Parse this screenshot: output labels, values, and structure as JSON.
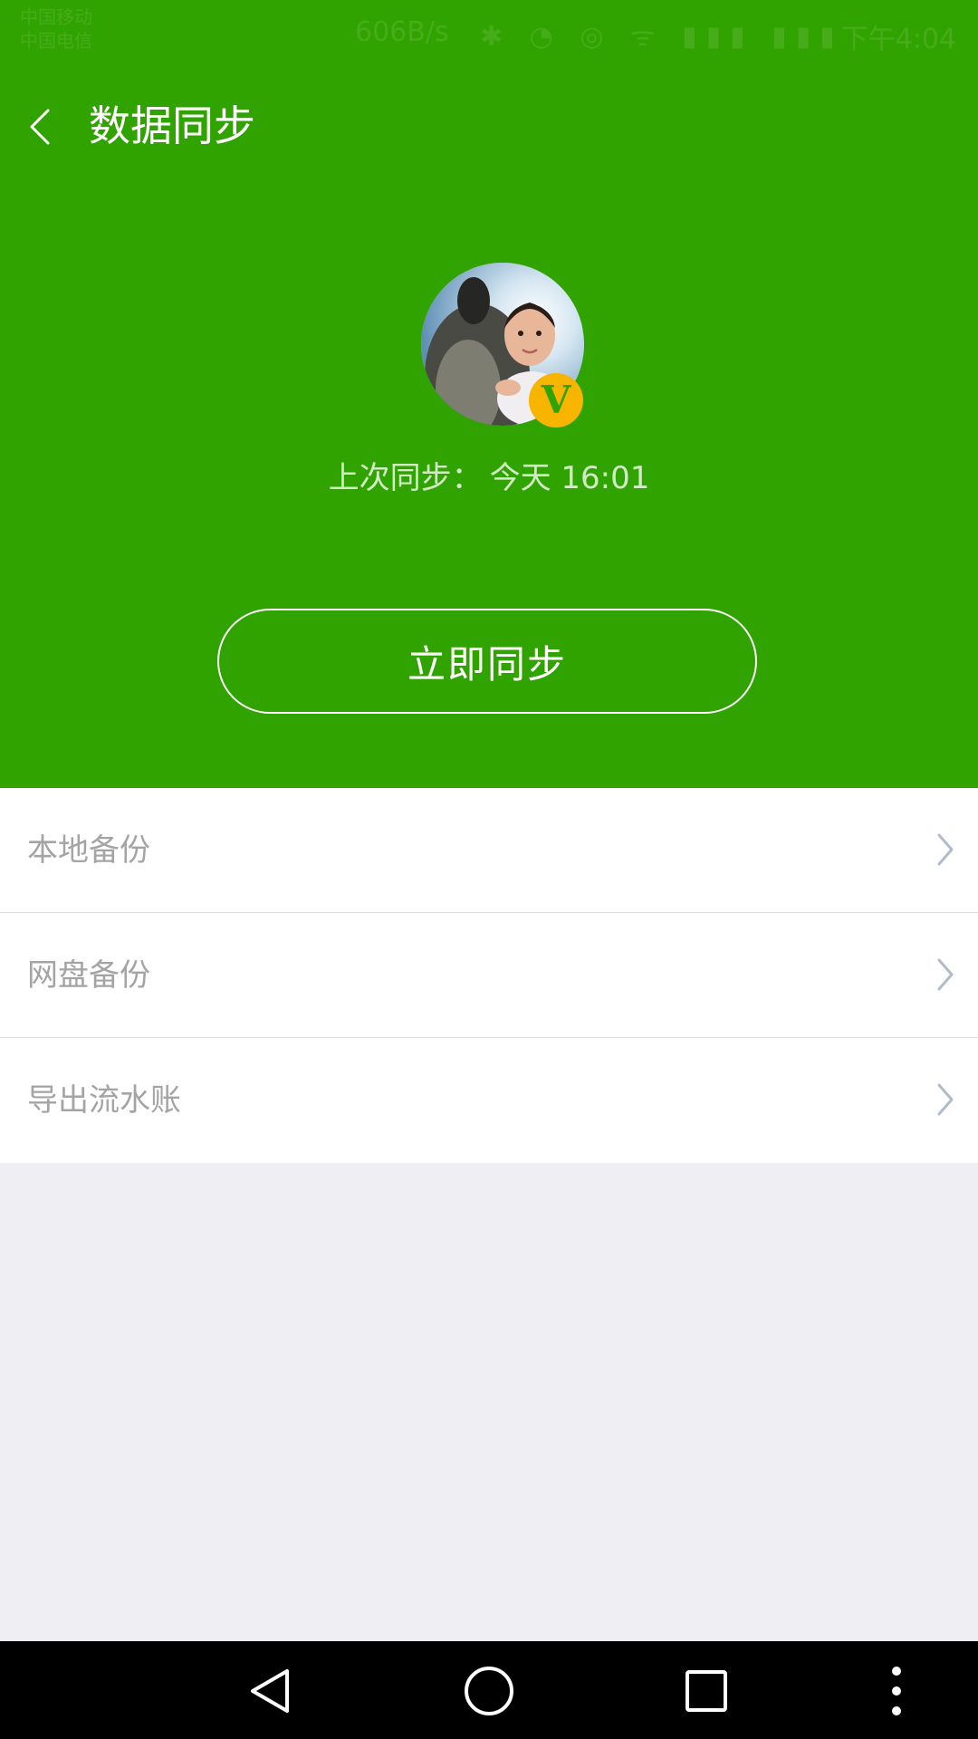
{
  "status_bar": {
    "carrier_line_1": "中国移动",
    "carrier_line_2": "中国电信",
    "speed": "606B/s",
    "icons": "✱ ◔ ◎ ᯤ ▮▮▮ ▮▮▮",
    "time": "下午4:04"
  },
  "header": {
    "title": "数据同步",
    "vip_badge": "V",
    "last_sync_label": "上次同步：",
    "last_sync_value": "今天 16:01",
    "sync_button_label": "立即同步"
  },
  "menu": {
    "items": [
      {
        "label": "本地备份"
      },
      {
        "label": "网盘备份"
      },
      {
        "label": "导出流水账"
      }
    ]
  },
  "icons": {
    "back": "back-arrow-icon",
    "chevron": "chevron-right-icon",
    "nav_back": "triangle-back-icon",
    "nav_home": "circle-home-icon",
    "nav_recents": "square-recents-icon",
    "nav_menu": "three-dots-icon"
  },
  "colors": {
    "header_green": "#31a300",
    "badge_yellow": "#f7b500",
    "list_text": "#a4a4a4",
    "page_background": "#eeeef3"
  }
}
